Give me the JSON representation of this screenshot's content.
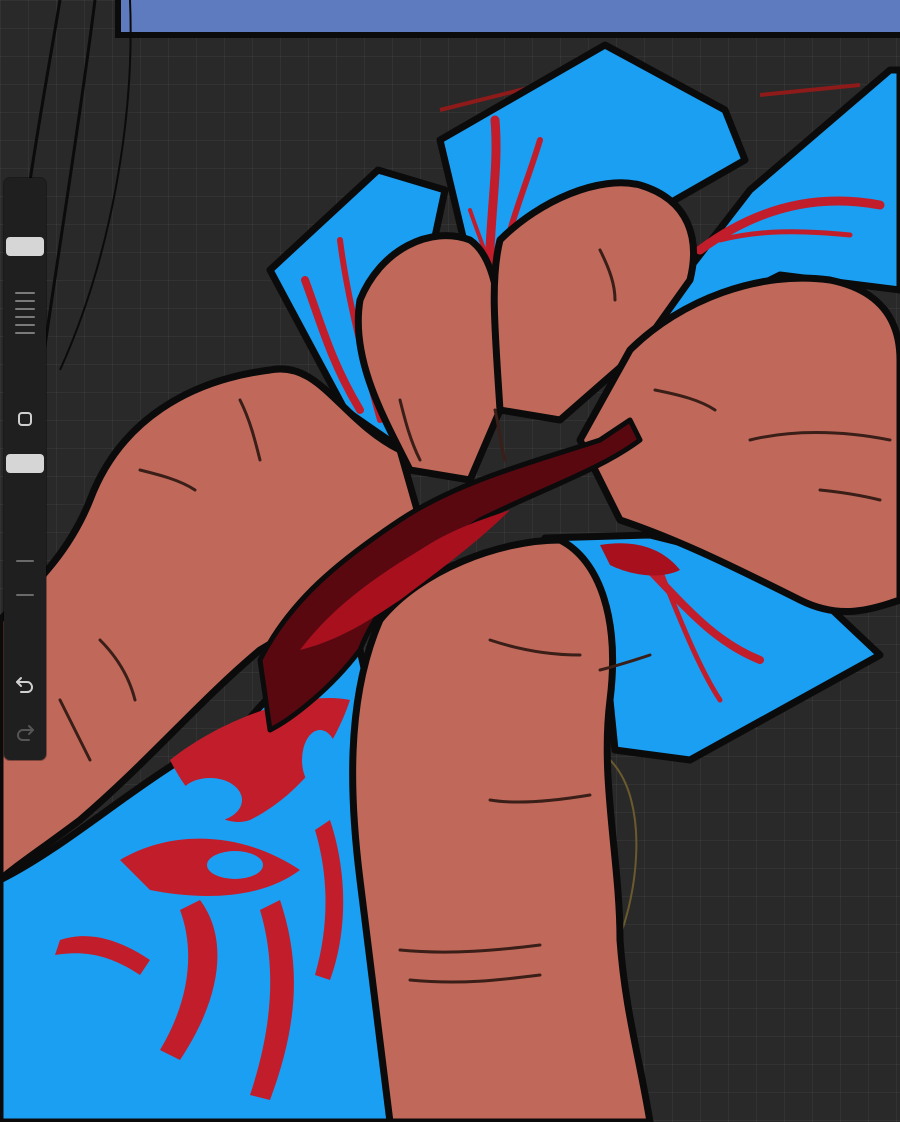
{
  "app": {
    "name": "Drawing canvas",
    "background": "#292929"
  },
  "sidebar": {
    "brush_size": 0.72,
    "brush_opacity": 0.55,
    "icons": {
      "size_ticks": "size-ticks-icon",
      "modify": "square-icon",
      "undo": "undo-arrow-icon",
      "redo": "redo-arrow-icon"
    }
  },
  "colors": {
    "skin": "#C0695A",
    "blue": "#1B9FF3",
    "blood": "#C21D2B",
    "dark_blood": "#5A0810",
    "outline": "#0B0B0B",
    "denim": "#5E7BC0"
  }
}
